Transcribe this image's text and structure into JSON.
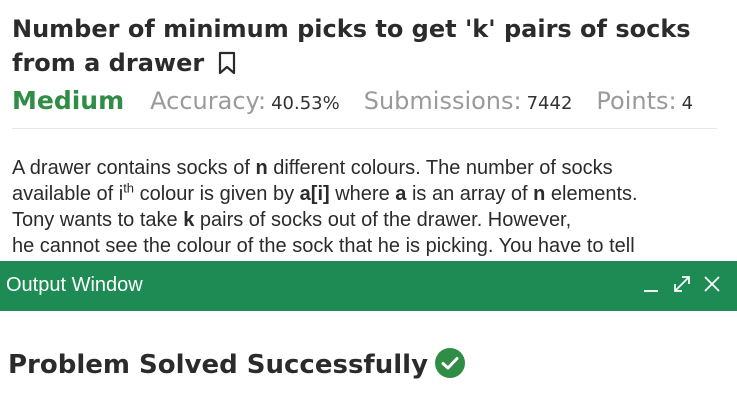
{
  "problem": {
    "title": "Number of minimum picks to get 'k' pairs of socks from a drawer",
    "difficulty": "Medium",
    "accuracy_label": "Accuracy:",
    "accuracy_value": "40.53%",
    "submissions_label": "Submissions:",
    "submissions_value": "7442",
    "points_label": "Points:",
    "points_value": "4",
    "description": {
      "l1a": "A drawer contains socks of ",
      "l1b": "n",
      "l1c": " different colours. The number of socks",
      "l2a": "available of i",
      "l2sup": "th",
      "l2b": " colour is given by ",
      "l2c": "a[i]",
      "l2d": " where ",
      "l2e": "a",
      "l2f": " is an array of ",
      "l2g": "n",
      "l2h": " elements.",
      "l3a": "Tony wants to take ",
      "l3b": "k",
      "l3c": " pairs of socks out of the drawer. However,",
      "l4": "he cannot see the colour of the sock that he is picking. You have to tell"
    }
  },
  "output_window": {
    "title": "Output Window",
    "message": "Problem Solved Successfully"
  },
  "icons": {
    "bookmark": "bookmark-icon",
    "minimize": "minimize-icon",
    "expand": "expand-icon",
    "close": "close-icon",
    "success": "check-circle-icon"
  },
  "colors": {
    "accent_green": "#2f8d46",
    "output_bar": "#1e8b55",
    "check_green": "#2f8d46"
  }
}
